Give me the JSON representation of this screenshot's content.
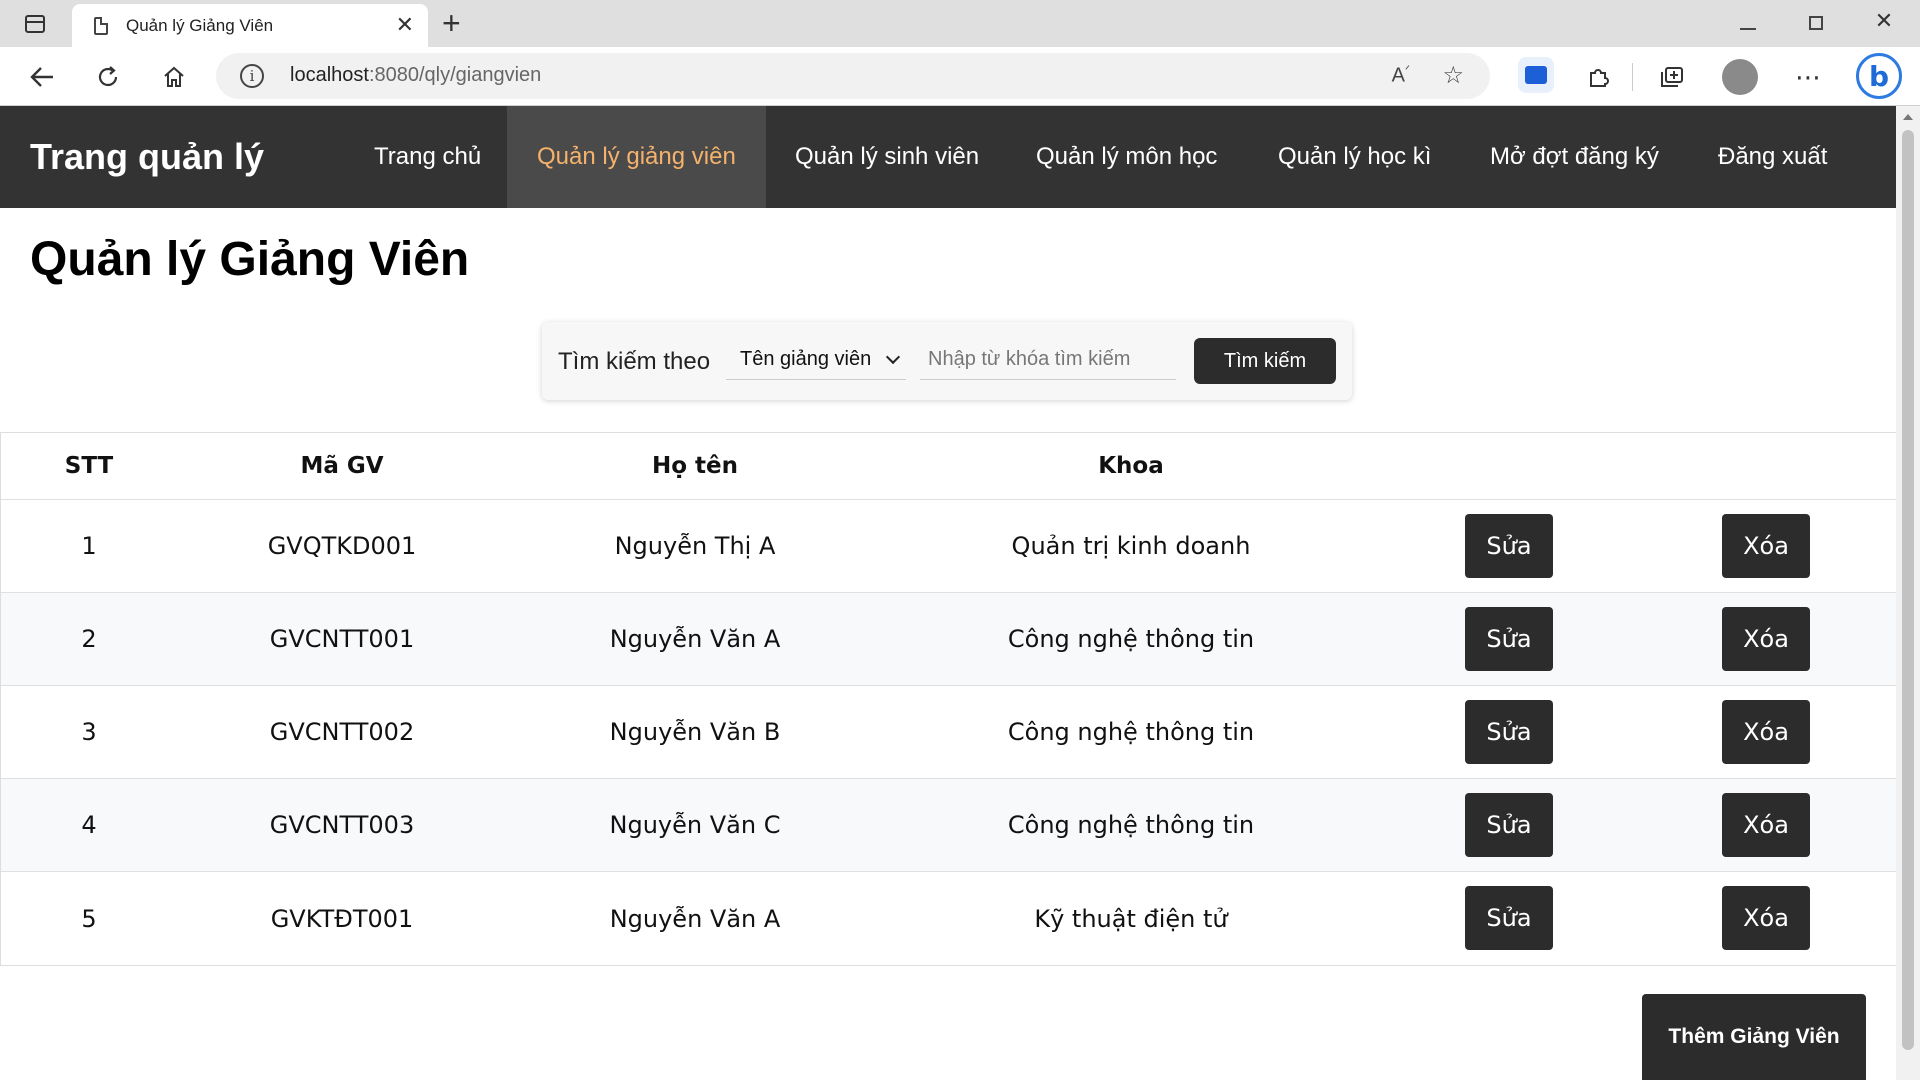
{
  "browser": {
    "tab_title": "Quản lý Giảng Viên",
    "url_host": "localhost",
    "url_rest": ":8080/qly/giangvien"
  },
  "navbar": {
    "brand": "Trang quản lý",
    "items": [
      {
        "label": "Trang chủ",
        "active": false
      },
      {
        "label": "Quản lý giảng viên",
        "active": true
      },
      {
        "label": "Quản lý sinh viên",
        "active": false
      },
      {
        "label": "Quản lý môn học",
        "active": false
      },
      {
        "label": "Quản lý học kì",
        "active": false
      },
      {
        "label": "Mở đợt đăng ký",
        "active": false
      },
      {
        "label": "Đăng xuất",
        "active": false
      }
    ],
    "active_color": "#f5b26b"
  },
  "page": {
    "title": "Quản lý Giảng Viên"
  },
  "search": {
    "label": "Tìm kiếm theo",
    "select_value": "Tên giảng viên",
    "input_placeholder": "Nhập từ khóa tìm kiếm",
    "button_label": "Tìm kiếm"
  },
  "table": {
    "headers": {
      "stt": "STT",
      "ma": "Mã GV",
      "ten": "Họ tên",
      "khoa": "Khoa"
    },
    "rows": [
      {
        "stt": "1",
        "ma": "GVQTKD001",
        "ten": "Nguyễn Thị A",
        "khoa": "Quản trị kinh doanh"
      },
      {
        "stt": "2",
        "ma": "GVCNTT001",
        "ten": "Nguyễn Văn A",
        "khoa": "Công nghệ thông tin"
      },
      {
        "stt": "3",
        "ma": "GVCNTT002",
        "ten": "Nguyễn Văn B",
        "khoa": "Công nghệ thông tin"
      },
      {
        "stt": "4",
        "ma": "GVCNTT003",
        "ten": "Nguyễn Văn C",
        "khoa": "Công nghệ thông tin"
      },
      {
        "stt": "5",
        "ma": "GVKTĐT001",
        "ten": "Nguyễn Văn A",
        "khoa": "Kỹ thuật điện tử"
      }
    ],
    "edit_label": "Sửa",
    "delete_label": "Xóa"
  },
  "add_button": "Thêm Giảng Viên"
}
